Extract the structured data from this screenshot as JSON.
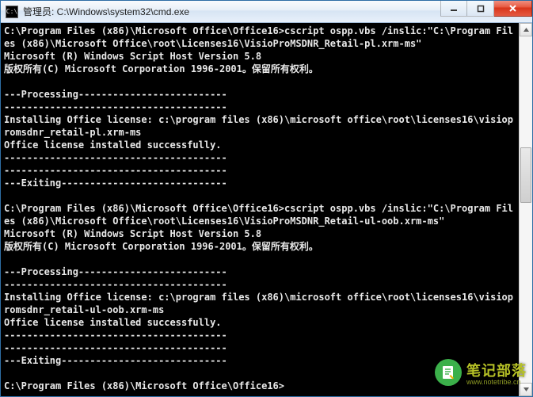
{
  "window": {
    "icon_label": "C:\\",
    "title": "管理员: C:\\Windows\\system32\\cmd.exe",
    "buttons": {
      "minimize": "min",
      "maximize": "max",
      "close": "close"
    }
  },
  "console": {
    "lines": [
      "C:\\Program Files (x86)\\Microsoft Office\\Office16>cscript ospp.vbs /inslic:\"C:\\Program Files (x86)\\Microsoft Office\\root\\Licenses16\\VisioProMSDNR_Retail-pl.xrm-ms\"",
      "Microsoft (R) Windows Script Host Version 5.8",
      "版权所有(C) Microsoft Corporation 1996-2001。保留所有权利。",
      "",
      "---Processing--------------------------",
      "---------------------------------------",
      "Installing Office license: c:\\program files (x86)\\microsoft office\\root\\licenses16\\visiopromsdnr_retail-pl.xrm-ms",
      "Office license installed successfully.",
      "---------------------------------------",
      "---------------------------------------",
      "---Exiting-----------------------------",
      "",
      "C:\\Program Files (x86)\\Microsoft Office\\Office16>cscript ospp.vbs /inslic:\"C:\\Program Files (x86)\\Microsoft Office\\root\\Licenses16\\VisioProMSDNR_Retail-ul-oob.xrm-ms\"",
      "Microsoft (R) Windows Script Host Version 5.8",
      "版权所有(C) Microsoft Corporation 1996-2001。保留所有权利。",
      "",
      "---Processing--------------------------",
      "---------------------------------------",
      "Installing Office license: c:\\program files (x86)\\microsoft office\\root\\licenses16\\visiopromsdnr_retail-ul-oob.xrm-ms",
      "Office license installed successfully.",
      "---------------------------------------",
      "---------------------------------------",
      "---Exiting-----------------------------",
      "",
      "C:\\Program Files (x86)\\Microsoft Office\\Office16>"
    ]
  },
  "watermark": {
    "cn": "笔记部落",
    "en": "www.notetribe.cn"
  }
}
